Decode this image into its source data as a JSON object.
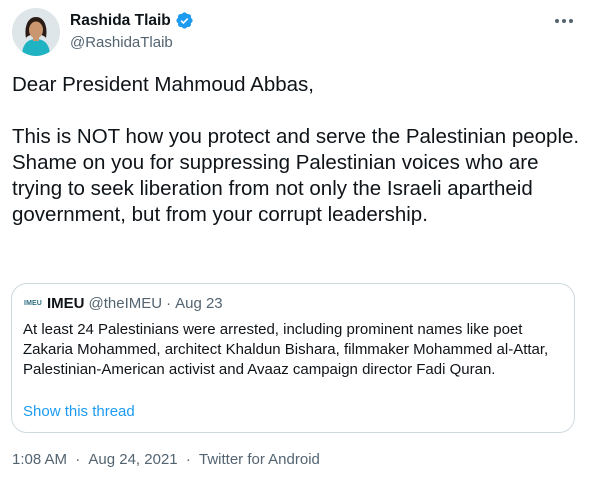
{
  "author": {
    "display_name": "Rashida Tlaib",
    "handle": "@RashidaTlaib",
    "verified": true,
    "avatar_icon": "profile-photo",
    "verified_icon": "verified-badge-icon",
    "verified_color": "#1d9bf0"
  },
  "tweet": {
    "paragraphs": [
      "Dear President Mahmoud Abbas,",
      "This is NOT how you protect and serve the Palestinian people. Shame on you for suppressing Palestinian voices who are trying to seek liberation from not only the Israeli apartheid government, but from your corrupt leadership."
    ]
  },
  "quote": {
    "avatar_text": "IMEU",
    "name": "IMEU",
    "handle": "@theIMEU",
    "separator": "·",
    "date": "Aug 23",
    "text": "At least 24 Palestinians were arrested, including prominent names like poet Zakaria Mohammed, architect Khaldun Bishara, filmmaker Mohammed al-Attar, Palestinian-American activist and Avaaz campaign director Fadi Quran.",
    "show_thread": "Show this thread"
  },
  "meta": {
    "time": "1:08 AM",
    "separator1": "·",
    "date": "Aug 24, 2021",
    "separator2": "·",
    "source": "Twitter for Android"
  },
  "colors": {
    "text": "#0f1419",
    "secondary": "#536471",
    "link": "#1d9bf0",
    "border": "#cfd9de"
  }
}
